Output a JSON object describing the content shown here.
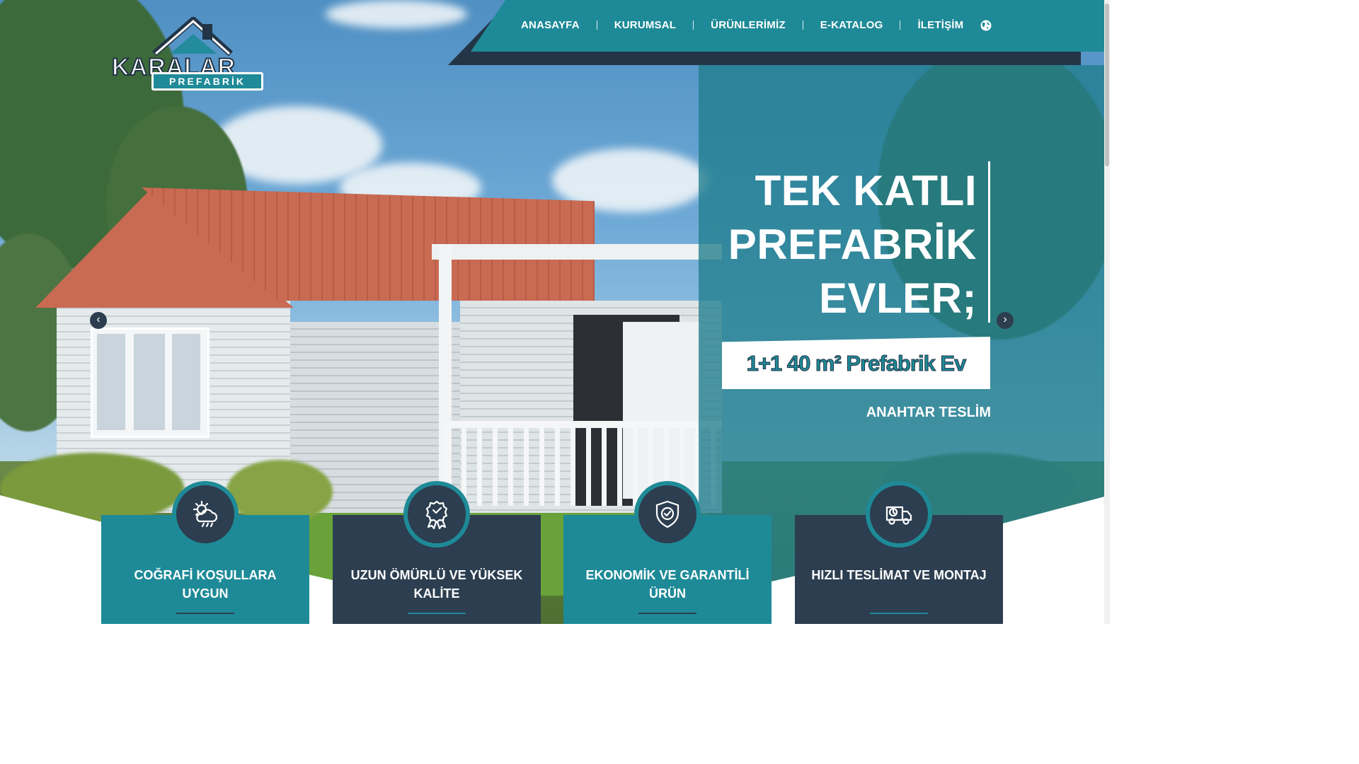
{
  "nav": {
    "items": [
      {
        "label": "ANASAYFA"
      },
      {
        "label": "KURUMSAL"
      },
      {
        "label": "ÜRÜNLERİMİZ"
      },
      {
        "label": "E-KATALOG"
      },
      {
        "label": "İLETİŞİM"
      }
    ],
    "language_icon": "globe-icon"
  },
  "logo": {
    "name": "KARALAR",
    "sub": "PREFABRİK"
  },
  "hero": {
    "title_lines": [
      "TEK KATLI",
      "PREFABRİK",
      "EVLER;"
    ],
    "tag": "1+1 40 m² Prefabrik Ev",
    "subtitle": "ANAHTAR TESLİM",
    "prev_icon": "chevron-left-icon",
    "next_icon": "chevron-right-icon",
    "prev_glyph": "‹",
    "next_glyph": "›"
  },
  "features": [
    {
      "label": "COĞRAFİ KOŞULLARA UYGUN",
      "icon": "weather-icon"
    },
    {
      "label": "UZUN ÖMÜRLÜ VE YÜKSEK KALİTE",
      "icon": "award-icon"
    },
    {
      "label": "EKONOMİK VE GARANTİLİ ÜRÜN",
      "icon": "shield-check-icon"
    },
    {
      "label": "HIZLI TESLİMAT VE MONTAJ",
      "icon": "delivery-truck-icon"
    }
  ],
  "colors": {
    "teal": "#1e8a97",
    "navy": "#2c3e50"
  }
}
